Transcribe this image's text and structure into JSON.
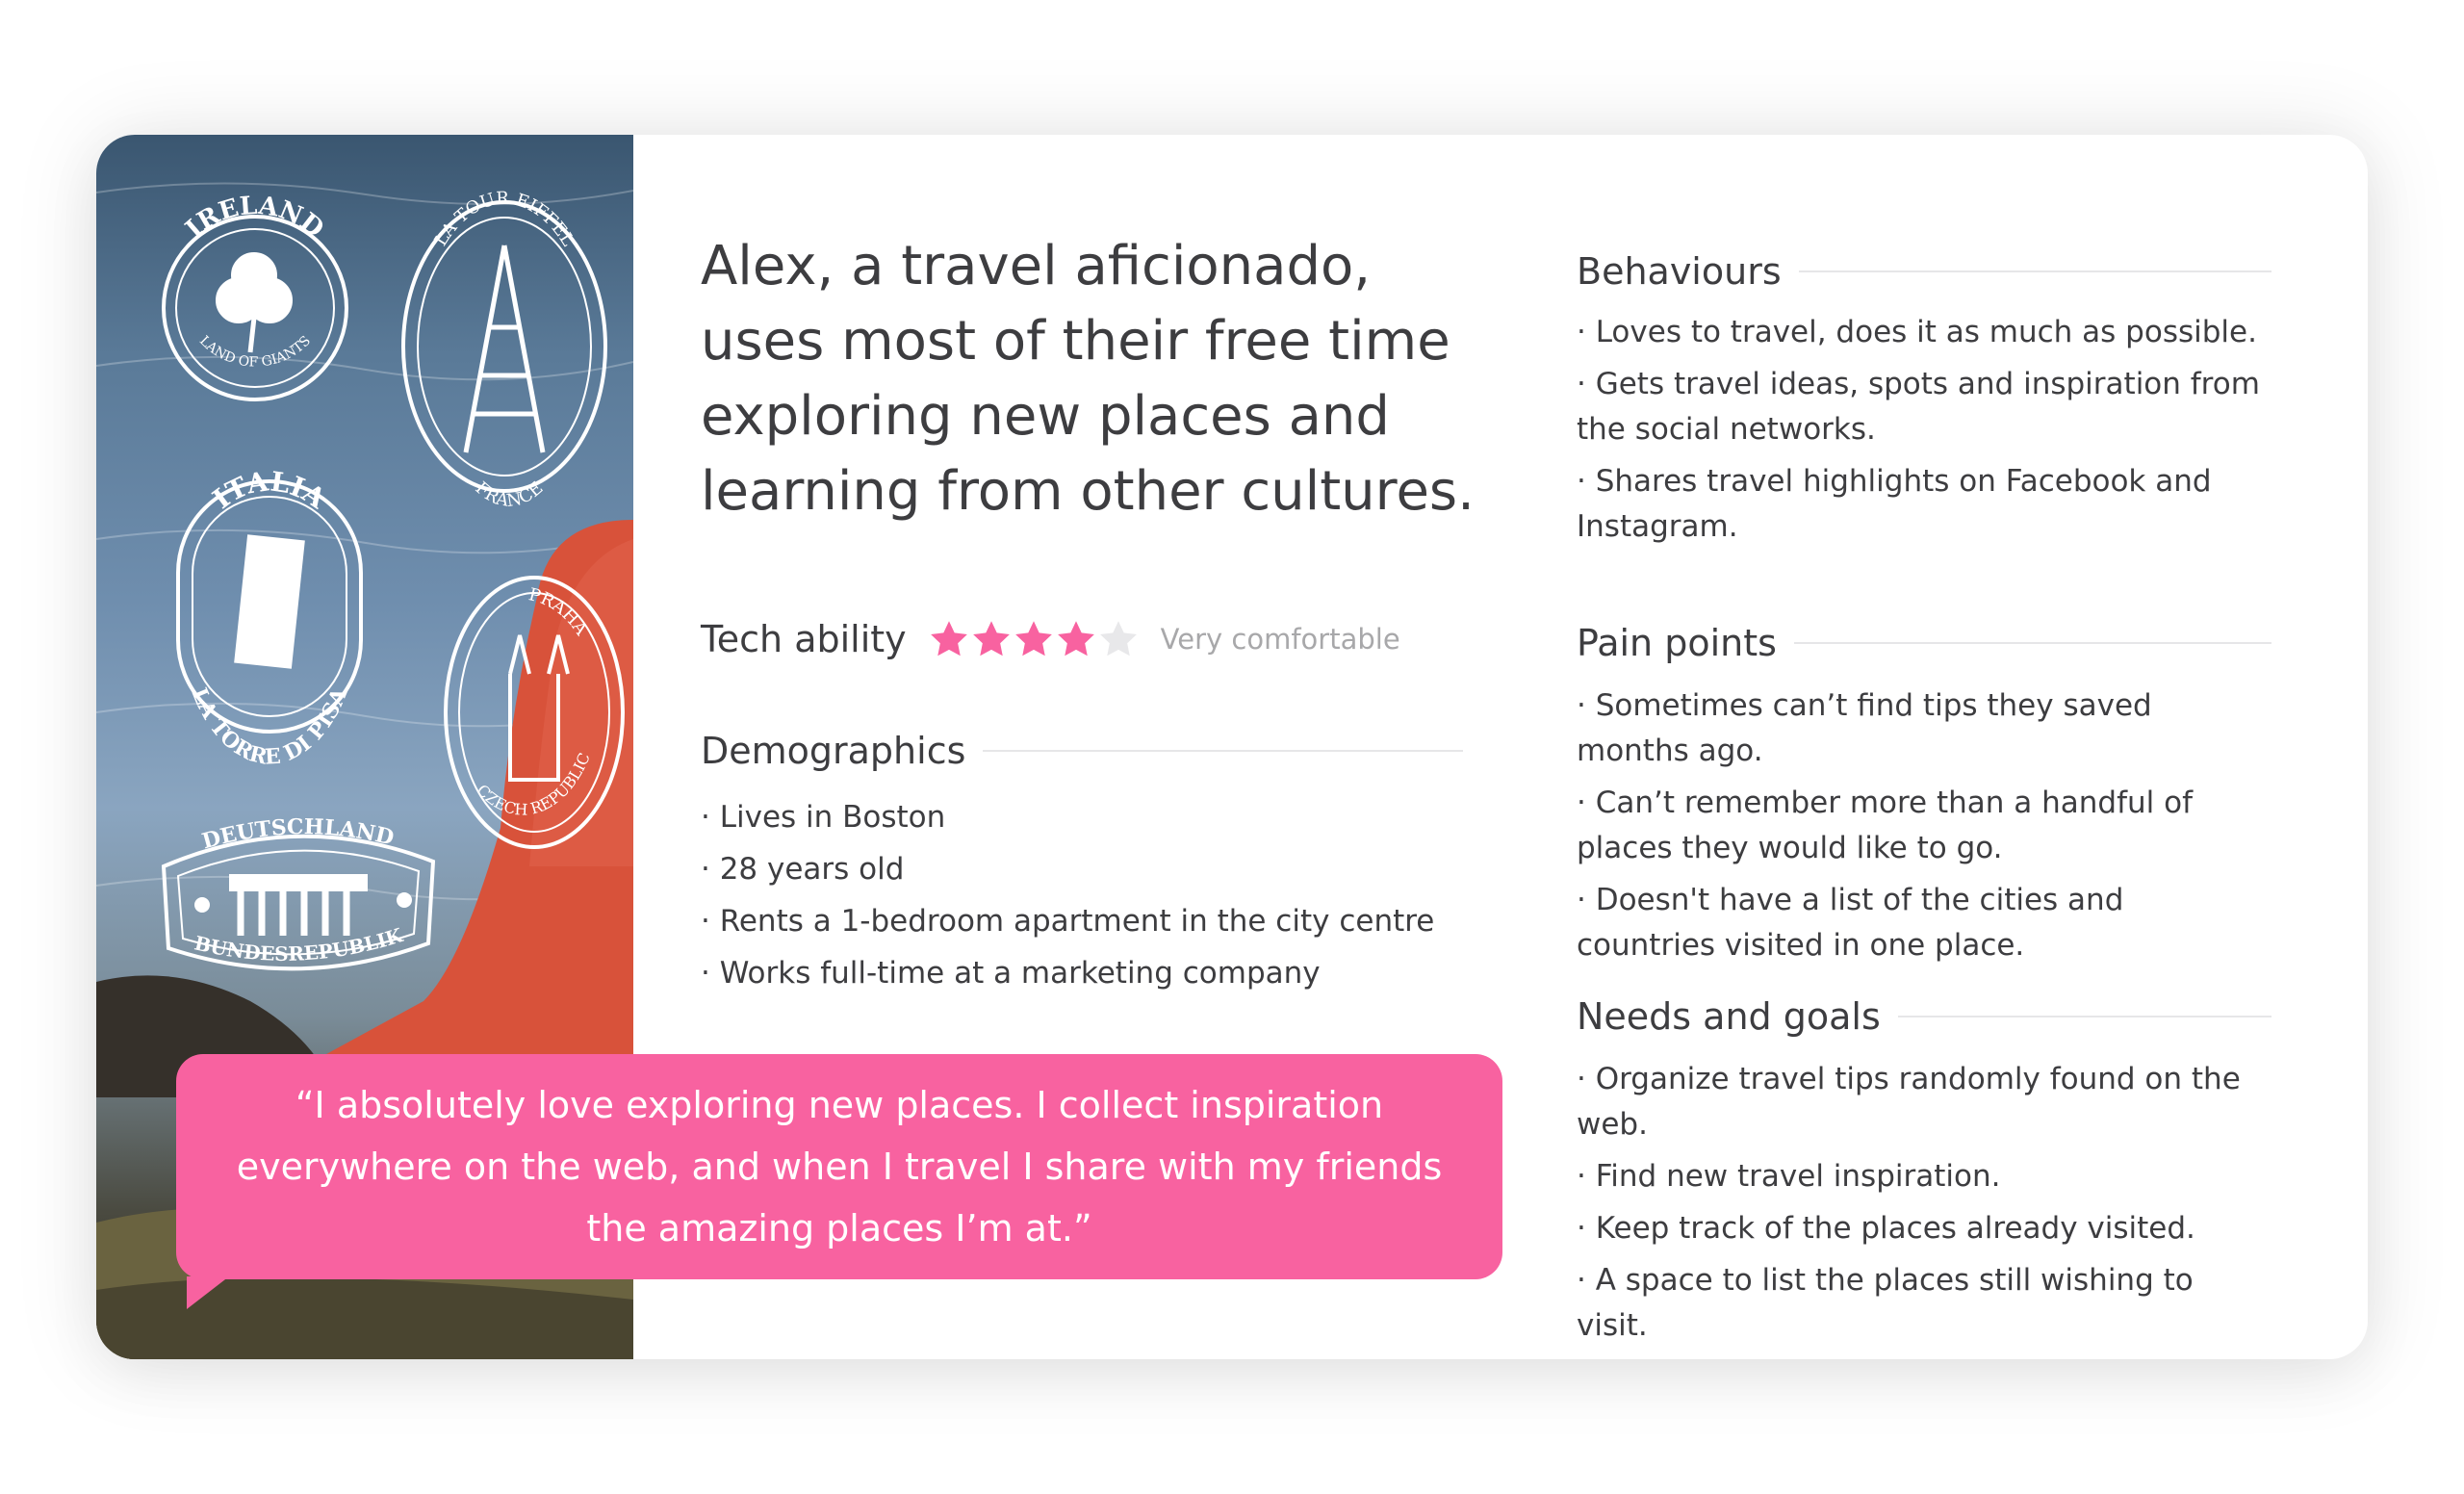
{
  "persona": {
    "headline": "Alex, a travel aficionado, uses most of their free time exploring new places and learning from other cultures.",
    "tech": {
      "label": "Tech ability",
      "rating": 4,
      "max_rating": 5,
      "note": "Very comfortable"
    },
    "demographics": {
      "title": "Demographics",
      "items": [
        "· Lives in Boston",
        "· 28 years old",
        "· Rents a 1-bedroom apartment in the city centre",
        "· Works full-time at a marketing company"
      ]
    },
    "behaviours": {
      "title": "Behaviours",
      "items": [
        "· Loves to travel, does it as much as possible.",
        "· Gets travel ideas, spots and inspiration from the social networks.",
        "· Shares travel highlights on Facebook and Instagram."
      ]
    },
    "pain_points": {
      "title": "Pain points",
      "items": [
        "· Sometimes can’t find tips they saved months ago.",
        "· Can’t remember more than a handful of places they would like to go.",
        "· Doesn't have a list of the cities and countries visited in one place."
      ]
    },
    "needs_goals": {
      "title": "Needs and goals",
      "items": [
        "· Organize travel tips randomly found on the web.",
        "· Find new travel inspiration.",
        "· Keep track of the places already visited.",
        "· A space to list the places still wishing to visit."
      ]
    },
    "quote": "“I absolutely love exploring new places. I collect inspiration everywhere on the web, and when I travel I share with my friends the amazing places I’m at.”"
  },
  "stamps": {
    "ireland": {
      "top": "IRELAND",
      "bottom": "LAND OF GIANTS"
    },
    "eiffel": {
      "top": "LA TOUR EIFFEL",
      "bottom": "FRANCE"
    },
    "italia": {
      "top": "ITALIA",
      "bottom": "LA TORRE DI PISA"
    },
    "praha": {
      "top": "PRAHA",
      "bottom": "CZECH REPUBLIC"
    },
    "deutschland": {
      "top": "DEUTSCHLAND",
      "bottom": "BUNDESREPUBLIK"
    }
  },
  "colors": {
    "accent": "#f862a0",
    "text": "#3d3d40",
    "muted": "#a8a8aa",
    "star_empty": "#e8e8ea",
    "rule": "#e6e6e8"
  }
}
